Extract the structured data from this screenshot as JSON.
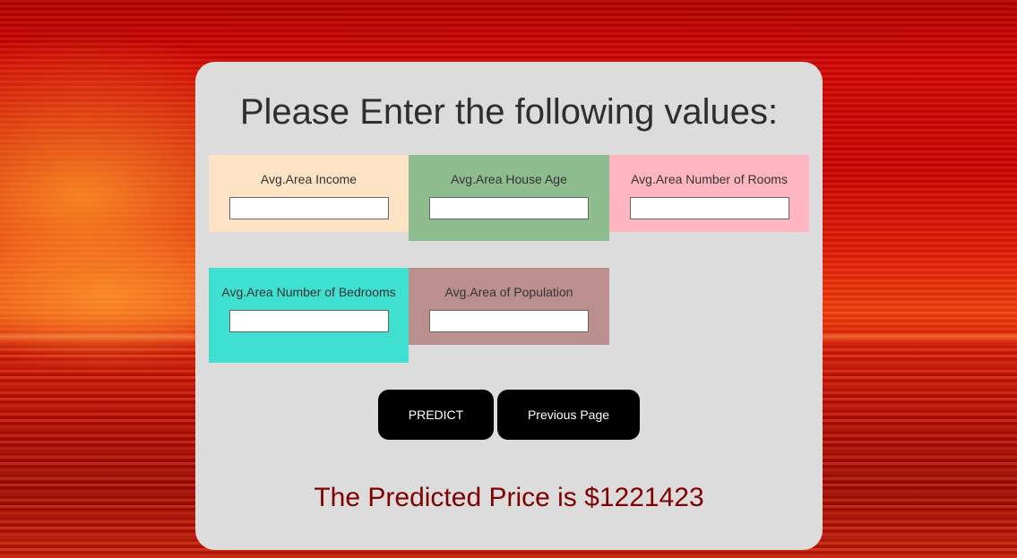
{
  "page": {
    "title": "Please Enter the following values:"
  },
  "fields": [
    {
      "label": "Avg.Area Income",
      "value": "",
      "color": "#fde3c3"
    },
    {
      "label": "Avg.Area House Age",
      "value": "",
      "color": "#8fbc8f"
    },
    {
      "label": "Avg.Area Number of Rooms",
      "value": "",
      "color": "#ffb6c1"
    },
    {
      "label": "Avg.Area Number of Bedrooms",
      "value": "",
      "color": "#40e0d0"
    },
    {
      "label": "Avg.Area of Population",
      "value": "",
      "color": "#bc8f8f"
    }
  ],
  "buttons": {
    "predict_label": "PREDICT",
    "previous_label": "Previous Page"
  },
  "result": {
    "text": "The Predicted Price is $1221423"
  },
  "colors": {
    "card_background": "#dcdcdc",
    "button_background": "#000000",
    "result_text": "#800000",
    "page_background": "#c80404"
  }
}
